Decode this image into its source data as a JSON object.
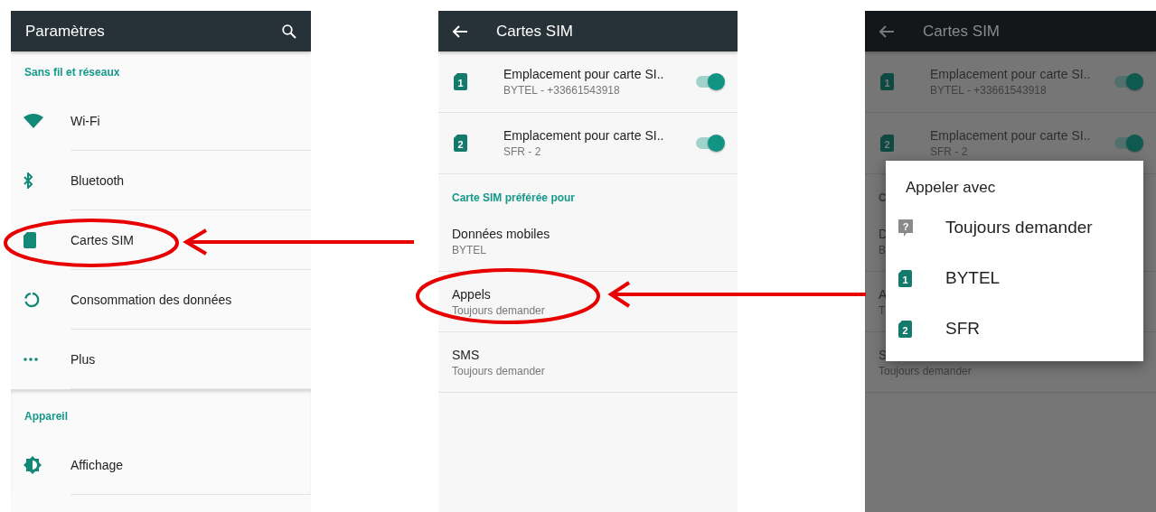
{
  "screens": [
    {
      "kind": "settings",
      "title": "Paramètres",
      "sections": [
        {
          "header": "Sans fil et réseaux",
          "items": [
            {
              "kind": "wifi",
              "label": "Wi-Fi"
            },
            {
              "kind": "bluetooth",
              "label": "Bluetooth"
            },
            {
              "kind": "sim",
              "label": "Cartes SIM"
            },
            {
              "kind": "data",
              "label": "Consommation des données"
            },
            {
              "kind": "more",
              "label": "Plus"
            }
          ]
        },
        {
          "header": "Appareil",
          "items": [
            {
              "kind": "display",
              "label": "Affichage"
            }
          ]
        }
      ]
    },
    {
      "kind": "sim_cards",
      "title": "Cartes SIM",
      "sims": [
        {
          "slot": "1",
          "title": "Emplacement pour carte SI..",
          "subtitle": "BYTEL - +33661543918",
          "on": true
        },
        {
          "slot": "2",
          "title": "Emplacement pour carte SI..",
          "subtitle": "SFR - 2",
          "on": true
        }
      ],
      "section_header": "Carte SIM préférée pour",
      "preferences": [
        {
          "title": "Données mobiles",
          "subtitle": "BYTEL"
        },
        {
          "title": "Appels",
          "subtitle": "Toujours demander"
        },
        {
          "title": "SMS",
          "subtitle": "Toujours demander"
        }
      ]
    },
    {
      "kind": "sim_cards_dialog",
      "title": "Cartes SIM",
      "sims": [
        {
          "slot": "1",
          "title": "Emplacement pour carte SI..",
          "subtitle": "BYTEL - +33661543918",
          "on": true
        },
        {
          "slot": "2",
          "title": "Emplacement pour carte SI..",
          "subtitle": "SFR - 2",
          "on": true
        }
      ],
      "section_header": "C",
      "preferences": [
        {
          "title": "D",
          "subtitle": "B"
        },
        {
          "title": "A",
          "subtitle": "T"
        },
        {
          "title": "S",
          "subtitle": "Toujours demander"
        }
      ],
      "dialog": {
        "title": "Appeler avec",
        "options": [
          {
            "kind": "ask",
            "badge": "?",
            "label": "Toujours demander"
          },
          {
            "kind": "sim",
            "badge": "1",
            "label": "BYTEL"
          },
          {
            "kind": "sim",
            "badge": "2",
            "label": "SFR"
          }
        ]
      }
    }
  ]
}
